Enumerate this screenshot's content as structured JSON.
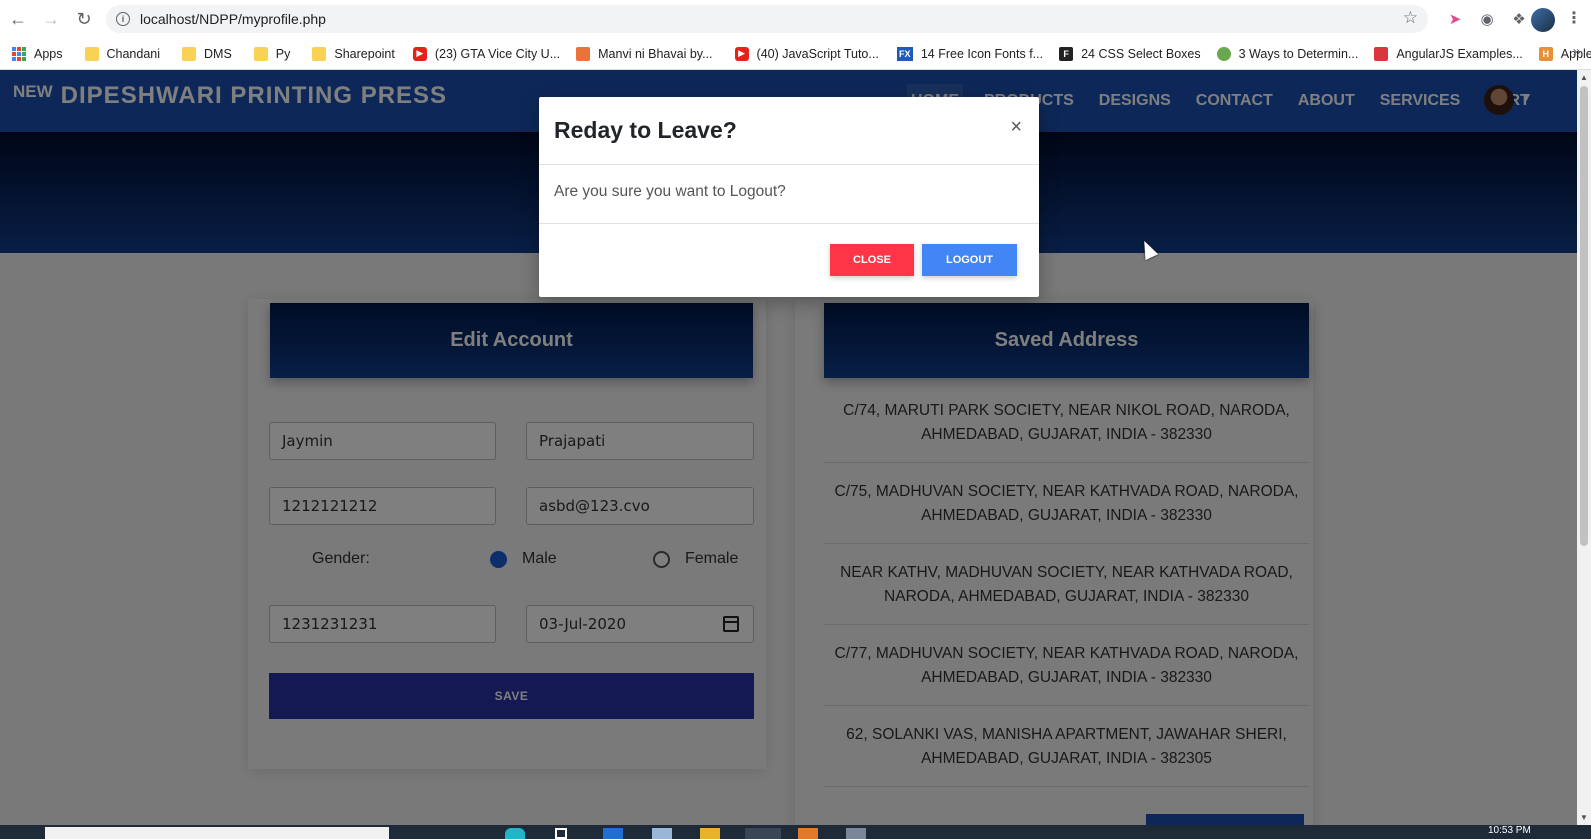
{
  "browser": {
    "url": "localhost/NDPP/myprofile.php",
    "bookmarks": [
      {
        "label": "Apps",
        "icon": "apps-grid-icon"
      },
      {
        "label": "Chandani",
        "icon": "folder-icon"
      },
      {
        "label": "DMS",
        "icon": "folder-icon"
      },
      {
        "label": "Py",
        "icon": "folder-icon"
      },
      {
        "label": "Sharepoint",
        "icon": "folder-icon"
      },
      {
        "label": "(23) GTA Vice City U...",
        "icon": "youtube-icon"
      },
      {
        "label": "Manvi ni Bhavai by...",
        "icon": "site-icon"
      },
      {
        "label": "(40) JavaScript Tuto...",
        "icon": "youtube-icon"
      },
      {
        "label": "14 Free Icon Fonts f...",
        "icon": "fx-icon"
      },
      {
        "label": "24 CSS Select Boxes",
        "icon": "site-icon"
      },
      {
        "label": "3 Ways to Determin...",
        "icon": "site-icon"
      },
      {
        "label": "AngularJS Examples...",
        "icon": "site-icon"
      },
      {
        "label": "Applets",
        "icon": "site-icon"
      }
    ],
    "bookmarks_more": "»"
  },
  "site": {
    "brand_new": "NEW",
    "brand_name": "DIPESHWARI PRINTING PRESS",
    "menu": [
      "HOME",
      "PRODUCTS",
      "DESIGNS",
      "CONTACT",
      "ABOUT",
      "SERVICES",
      "CART"
    ]
  },
  "edit_account": {
    "title": "Edit Account",
    "first_name": "Jaymin",
    "last_name": "Prajapati",
    "phone": "1212121212",
    "email": "asbd@123.cvo",
    "gender_label": "Gender:",
    "gender_options": [
      "Male",
      "Female"
    ],
    "gender_selected": "Male",
    "alt_phone": "1231231231",
    "dob": "03-Jul-2020",
    "save_label": "SAVE"
  },
  "saved_address": {
    "title": "Saved Address",
    "addresses": [
      "C/74, MARUTI PARK SOCIETY, NEAR NIKOL ROAD, NARODA, AHMEDABAD, GUJARAT, INDIA - 382330",
      "C/75, MADHUVAN SOCIETY, NEAR KATHVADA ROAD, NARODA, AHMEDABAD, GUJARAT, INDIA - 382330",
      "NEAR KATHV, MADHUVAN SOCIETY, NEAR KATHVADA ROAD, NARODA, AHMEDABAD, GUJARAT, INDIA - 382330",
      "C/77, MADHUVAN SOCIETY, NEAR KATHVADA ROAD, NARODA, AHMEDABAD, GUJARAT, INDIA - 382330",
      "62, SOLANKI VAS, MANISHA APARTMENT, JAWAHAR SHERI, AHMEDABAD, GUJARAT, INDIA - 382305"
    ]
  },
  "modal": {
    "title": "Reday to Leave?",
    "close_x": "×",
    "body": "Are you sure you want to Logout?",
    "close_label": "CLOSE",
    "logout_label": "LOGOUT"
  },
  "taskbar": {
    "time": "10:53 PM"
  },
  "colors": {
    "navbar": "#1a50b0",
    "close_button": "#ff3547",
    "logout_button": "#4285f4",
    "save_button": "#2832a8"
  }
}
